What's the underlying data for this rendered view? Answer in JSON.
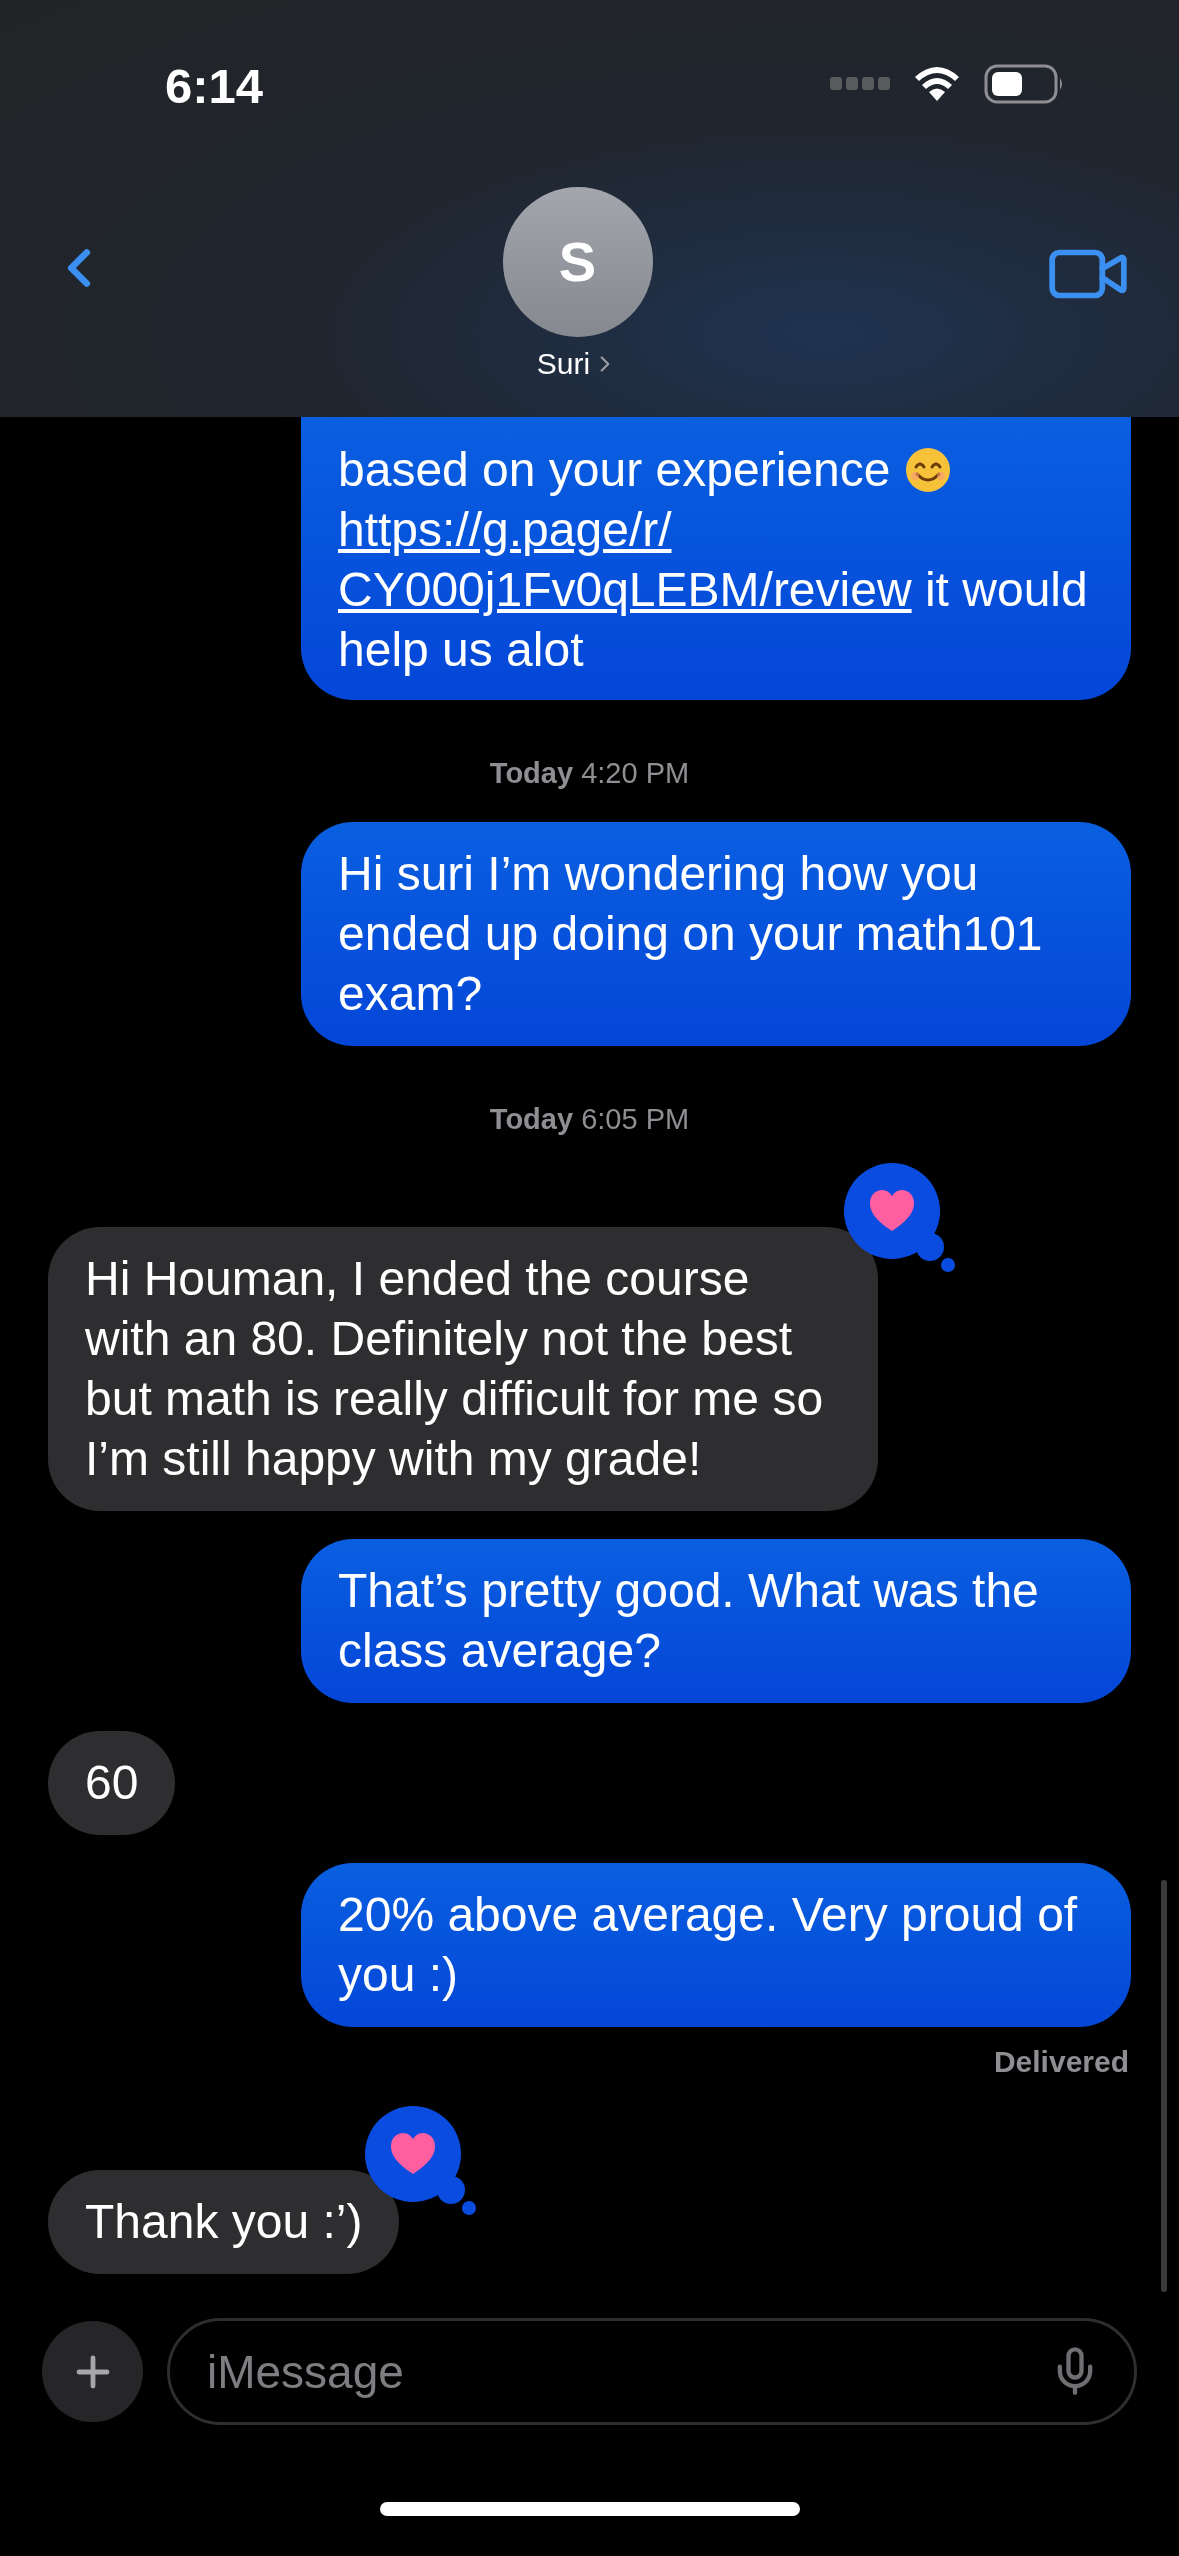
{
  "status_bar": {
    "time": "6:14"
  },
  "header": {
    "avatar_initial": "S",
    "contact_name": "Suri"
  },
  "messages": [
    {
      "kind": "sent",
      "reacted": false,
      "parts": [
        {
          "kind": "text",
          "text": "based on your experience"
        },
        {
          "kind": "emoji"
        },
        {
          "kind": "link",
          "text": "https://g.page/r/"
        },
        {
          "kind": "link",
          "text": "CY000j1Fv0qLEBM/review"
        },
        {
          "kind": "text",
          "text": " it would help us alot"
        }
      ]
    },
    {
      "kind": "timestamp",
      "day": "Today",
      "time": "4:20 PM"
    },
    {
      "kind": "sent",
      "reacted": false,
      "parts": [
        {
          "kind": "text",
          "text": "Hi suri I’m wondering how you ended up doing on your math101 exam?"
        }
      ]
    },
    {
      "kind": "timestamp",
      "day": "Today",
      "time": "6:05 PM"
    },
    {
      "kind": "received",
      "reacted": true,
      "parts": [
        {
          "kind": "text",
          "text": "Hi Houman, I ended the course with an 80. Definitely not the best but math is really difficult for me so I’m still happy with my grade!"
        }
      ]
    },
    {
      "kind": "sent",
      "reacted": false,
      "parts": [
        {
          "kind": "text",
          "text": "That’s pretty good. What was the class average?"
        }
      ]
    },
    {
      "kind": "received",
      "reacted": false,
      "parts": [
        {
          "kind": "text",
          "text": "60"
        }
      ]
    },
    {
      "kind": "sent",
      "reacted": false,
      "parts": [
        {
          "kind": "text",
          "text": "20% above average. Very proud of you :)"
        }
      ]
    },
    {
      "kind": "status",
      "text": "Delivered"
    },
    {
      "kind": "received",
      "reacted": true,
      "parts": [
        {
          "kind": "text",
          "text": "Thank you :’)"
        }
      ]
    }
  ],
  "composer": {
    "placeholder": "iMessage"
  }
}
